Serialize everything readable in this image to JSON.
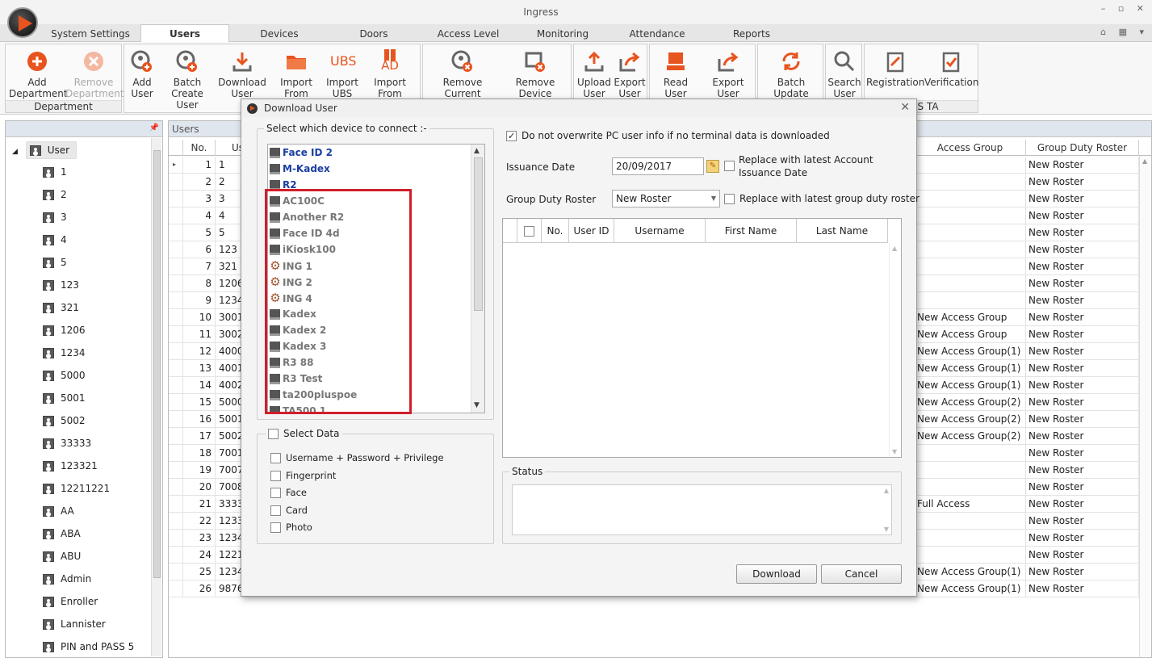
{
  "app": {
    "title": "Ingress"
  },
  "tabs": [
    "System Settings",
    "Users",
    "Devices",
    "Doors",
    "Access Level",
    "Monitoring",
    "Attendance",
    "Reports"
  ],
  "ribbon": {
    "add_department": "Add\nDepartment",
    "remove_department": "Remove\nDepartment",
    "department_group": "Department",
    "add_user": "Add\nUser",
    "batch_create_user": "Batch Create\nUser",
    "download_user": "Download\nUser",
    "import_from_file": "Import From\nFile",
    "import_ubs": "Import\nUBS",
    "import_from_ad": "Import From\nAD",
    "remove_current_user": "Remove Current\nUser",
    "remove_device_user": "Remove Device\nUser",
    "upload_user": "Upload\nUser",
    "export_user": "Export\nUser",
    "read_user_from_usb": "Read User\nfrom USB",
    "export_user_to_usb": "Export User\nto USB",
    "batch_update_user": "Batch Update\nUser",
    "search_user": "Search\nUser",
    "registration": "Registration",
    "verification": "Verification",
    "ta_group": "IS TA",
    "ubs_text": "UBS",
    "ad_text": "AD"
  },
  "tree": {
    "root": "User",
    "items": [
      "1",
      "2",
      "3",
      "4",
      "5",
      "123",
      "321",
      "1206",
      "1234",
      "5000",
      "5001",
      "5002",
      "33333",
      "123321",
      "12211221",
      "AA",
      "ABA",
      "ABU",
      "Admin",
      "Enroller",
      "Lannister",
      "PIN and PASS 5"
    ]
  },
  "grid": {
    "title": "Users",
    "headers": {
      "no": "No.",
      "user": "Us",
      "access_group": "Access Group",
      "group_duty_roster": "Group Duty Roster"
    },
    "rows": [
      {
        "no": "1",
        "id": "1",
        "ag": "",
        "roster": "New Roster"
      },
      {
        "no": "2",
        "id": "2",
        "ag": "",
        "roster": "New Roster"
      },
      {
        "no": "3",
        "id": "3",
        "ag": "",
        "roster": "New Roster"
      },
      {
        "no": "4",
        "id": "4",
        "ag": "",
        "roster": "New Roster"
      },
      {
        "no": "5",
        "id": "5",
        "ag": "",
        "roster": "New Roster"
      },
      {
        "no": "6",
        "id": "123",
        "ag": "",
        "roster": "New Roster"
      },
      {
        "no": "7",
        "id": "321",
        "ag": "",
        "roster": "New Roster"
      },
      {
        "no": "8",
        "id": "1206",
        "ag": "",
        "roster": "New Roster"
      },
      {
        "no": "9",
        "id": "1234",
        "ag": "",
        "roster": "New Roster"
      },
      {
        "no": "10",
        "id": "3001",
        "ag": "New Access Group",
        "roster": "New Roster"
      },
      {
        "no": "11",
        "id": "3002",
        "ag": "New Access Group",
        "roster": "New Roster"
      },
      {
        "no": "12",
        "id": "4000",
        "ag": "New Access Group(1)",
        "roster": "New Roster"
      },
      {
        "no": "13",
        "id": "4001",
        "ag": "New Access Group(1)",
        "roster": "New Roster"
      },
      {
        "no": "14",
        "id": "4002",
        "ag": "New Access Group(1)",
        "roster": "New Roster"
      },
      {
        "no": "15",
        "id": "5000",
        "ag": "New Access Group(2)",
        "roster": "New Roster"
      },
      {
        "no": "16",
        "id": "5001",
        "ag": "New Access Group(2)",
        "roster": "New Roster"
      },
      {
        "no": "17",
        "id": "5002",
        "ag": "New Access Group(2)",
        "roster": "New Roster"
      },
      {
        "no": "18",
        "id": "7001",
        "ag": "",
        "roster": "New Roster"
      },
      {
        "no": "19",
        "id": "7007",
        "ag": "",
        "roster": "New Roster"
      },
      {
        "no": "20",
        "id": "7008",
        "ag": "",
        "roster": "New Roster"
      },
      {
        "no": "21",
        "id": "33333",
        "ag": "Full Access",
        "roster": "New Roster"
      },
      {
        "no": "22",
        "id": "12332",
        "ag": "",
        "roster": "New Roster"
      },
      {
        "no": "23",
        "id": "12345",
        "ag": "",
        "roster": "New Roster"
      },
      {
        "no": "24",
        "id": "12211",
        "ag": "",
        "roster": "New Roster"
      },
      {
        "no": "25",
        "id": "12345",
        "ag": "New Access Group(1)",
        "roster": "New Roster"
      },
      {
        "no": "26",
        "id": "98765",
        "ag": "New Access Group(1)",
        "roster": "New Roster"
      }
    ]
  },
  "dialog": {
    "title": "Download User",
    "device_section": "Select which device to connect :-",
    "devices": [
      {
        "name": "Face ID 2",
        "status": "online",
        "icon": "device-icon"
      },
      {
        "name": "M-Kadex",
        "status": "online",
        "icon": "device-icon"
      },
      {
        "name": "R2",
        "status": "online",
        "icon": "device-icon"
      },
      {
        "name": "AC100C",
        "status": "offline",
        "icon": "device-icon"
      },
      {
        "name": "Another R2",
        "status": "offline",
        "icon": "device-icon"
      },
      {
        "name": "Face ID 4d",
        "status": "offline",
        "icon": "device-icon"
      },
      {
        "name": "iKiosk100",
        "status": "offline",
        "icon": "device-icon"
      },
      {
        "name": "ING 1",
        "status": "offline",
        "icon": "gear-icon"
      },
      {
        "name": "ING 2",
        "status": "offline",
        "icon": "gear-icon"
      },
      {
        "name": "ING 4",
        "status": "offline",
        "icon": "gear-icon"
      },
      {
        "name": "Kadex",
        "status": "offline",
        "icon": "device-icon"
      },
      {
        "name": "Kadex 2",
        "status": "offline",
        "icon": "device-icon"
      },
      {
        "name": "Kadex 3",
        "status": "offline",
        "icon": "device-icon"
      },
      {
        "name": "R3 88",
        "status": "offline",
        "icon": "device-icon"
      },
      {
        "name": "R3 Test",
        "status": "offline",
        "icon": "device-icon"
      },
      {
        "name": "ta200pluspoe",
        "status": "offline",
        "icon": "device-icon"
      },
      {
        "name": "TA500 1",
        "status": "offline",
        "icon": "device-icon"
      }
    ],
    "select_data": "Select Data",
    "data_options": [
      "Username + Password + Privilege",
      "Fingerprint",
      "Face",
      "Card",
      "Photo"
    ],
    "no_overwrite": "Do not overwrite PC user info if no terminal data is downloaded",
    "issuance_label": "Issuance Date",
    "issuance_value": "20/09/2017",
    "replace_issuance": "Replace with latest Account Issuance Date",
    "roster_label": "Group Duty Roster",
    "roster_value": "New Roster",
    "replace_roster": "Replace with latest group duty roster",
    "user_headers": [
      "No.",
      "User ID",
      "Username",
      "First Name",
      "Last Name"
    ],
    "status_label": "Status",
    "download_btn": "Download",
    "cancel_btn": "Cancel"
  },
  "colors": {
    "accent": "#e8541f",
    "highlight": "#d11e2a",
    "online": "#1a3fa3"
  }
}
